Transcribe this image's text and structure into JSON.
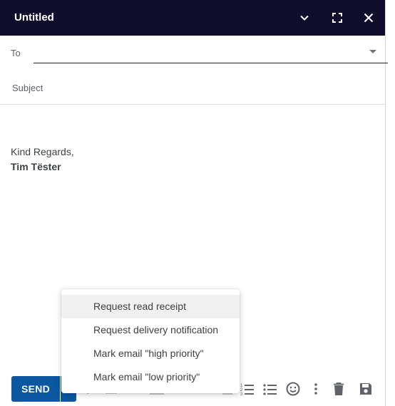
{
  "window": {
    "title": "Untitled"
  },
  "compose": {
    "to_label": "To",
    "to_value": "",
    "subject_placeholder": "Subject",
    "subject_value": "",
    "signature": {
      "line1": "Kind Regards,",
      "line2": "Tim Tëster"
    }
  },
  "toolbar": {
    "send_label": "SEND"
  },
  "send_menu": {
    "items": [
      {
        "label": "Request read receipt"
      },
      {
        "label": "Request delivery notification"
      },
      {
        "label": "Mark email \"high priority\""
      },
      {
        "label": "Mark email \"low priority\""
      }
    ]
  },
  "colors": {
    "titlebar": "#0f0d2b",
    "send_button": "#0b57a0"
  },
  "icons": [
    "chevron-down-icon",
    "fullscreen-icon",
    "close-icon",
    "numbered-list-icon",
    "bulleted-list-icon",
    "emoji-icon",
    "more-vert-icon",
    "trash-icon",
    "save-icon"
  ]
}
